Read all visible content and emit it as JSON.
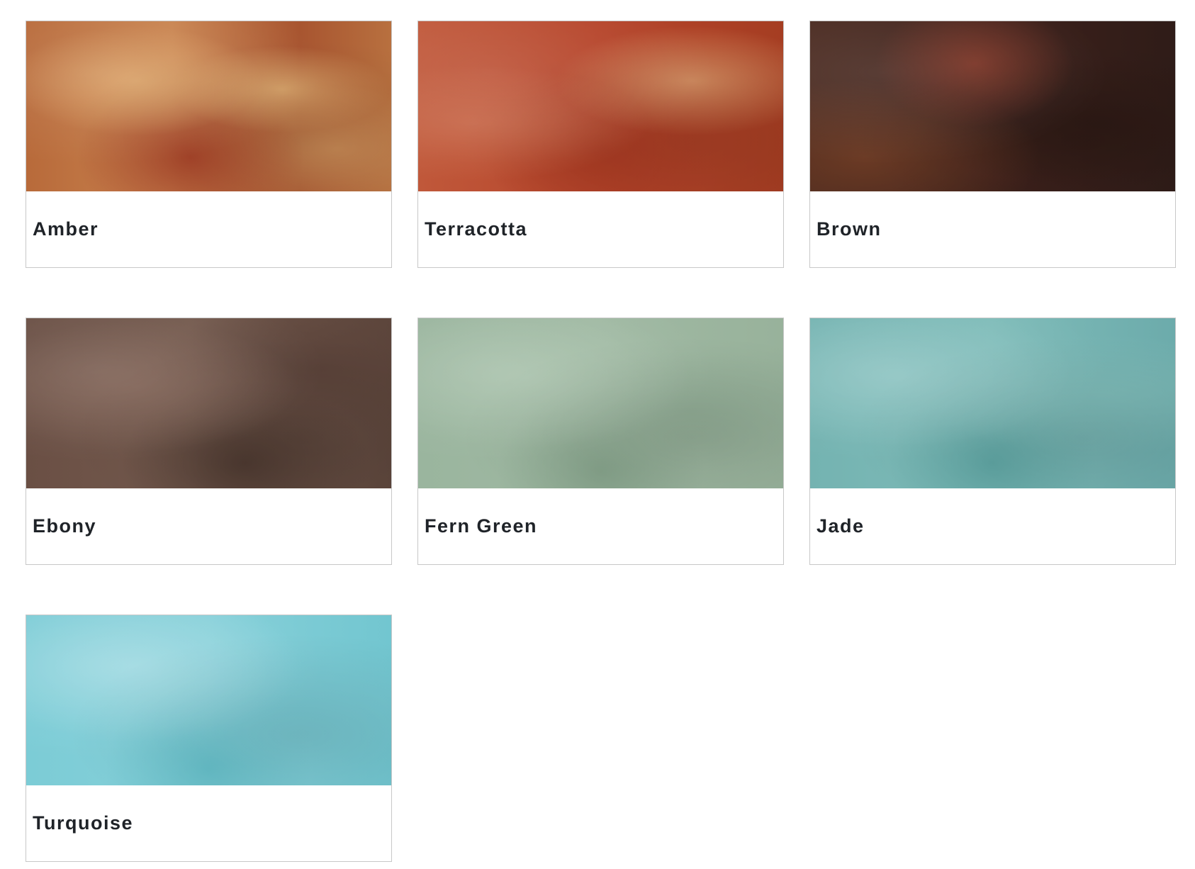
{
  "swatches": [
    {
      "name": "Amber",
      "color": "#b86a3a"
    },
    {
      "name": "Terracotta",
      "color": "#b6452b"
    },
    {
      "name": "Brown",
      "color": "#3e211b"
    },
    {
      "name": "Ebony",
      "color": "#6a4f44"
    },
    {
      "name": "Fern Green",
      "color": "#9ab59e"
    },
    {
      "name": "Jade",
      "color": "#74b3b1"
    },
    {
      "name": "Turquoise",
      "color": "#7cccd6"
    }
  ]
}
